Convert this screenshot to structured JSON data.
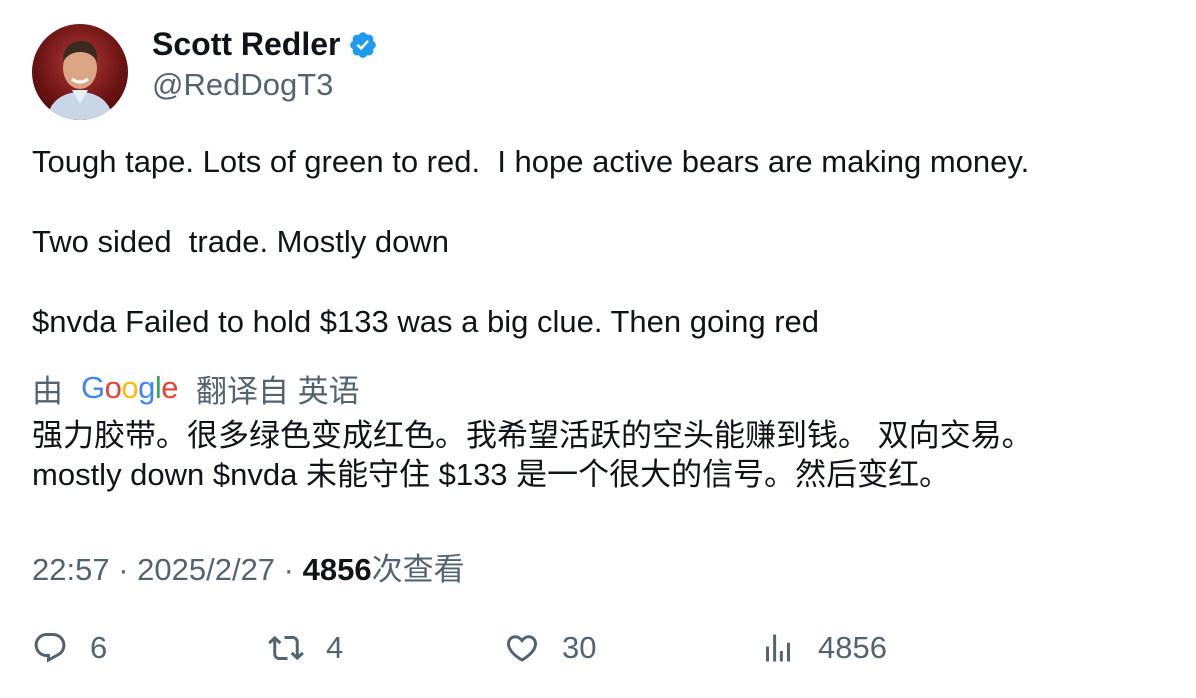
{
  "author": {
    "display_name": "Scott Redler",
    "handle": "@RedDogT3",
    "verified_icon": "verified-badge-icon"
  },
  "tweet": {
    "text": "Tough tape. Lots of green to red.  I hope active bears are making money.\n\nTwo sided  trade. Mostly down\n\n$nvda Failed to hold $133 was a big clue. Then going red"
  },
  "translation": {
    "by_label": "由",
    "provider": "Google",
    "from_label": "翻译自 英语",
    "text_line1": "强力胶带。很多绿色变成红色。我希望活跃的空头能赚到钱。 双向交易。",
    "text_line2": "mostly down $nvda 未能守住 $133 是一个很大的信号。然后变红。"
  },
  "meta": {
    "time": "22:57",
    "separator": " · ",
    "date": "2025/2/27",
    "views_count": "4856",
    "views_label": "次查看"
  },
  "actions": {
    "replies": "6",
    "retweets": "4",
    "likes": "30",
    "views": "4856"
  },
  "colors": {
    "text_primary": "#0f1419",
    "text_secondary": "#536471",
    "verified_blue": "#1d9bf0"
  }
}
